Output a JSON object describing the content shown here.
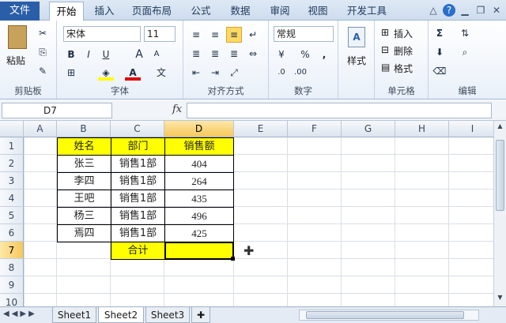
{
  "menu": {
    "file": "文件",
    "tabs": [
      "开始",
      "插入",
      "页面布局",
      "公式",
      "数据",
      "审阅",
      "视图",
      "开发工具"
    ]
  },
  "window_controls": {
    "minimize": "△",
    "help": "?",
    "restore": "❐",
    "close": "✕"
  },
  "ribbon": {
    "clipboard": {
      "paste": "粘贴",
      "label": "剪贴板"
    },
    "font": {
      "name": "宋体",
      "size": "11",
      "bold": "B",
      "italic": "I",
      "underline": "U",
      "grow": "A",
      "shrink": "A",
      "label": "字体"
    },
    "alignment": {
      "label": "对齐方式"
    },
    "number": {
      "format": "常规",
      "percent": "%",
      "comma": ",",
      "label": "数字"
    },
    "styles": {
      "label": "样式"
    },
    "cells": {
      "insert": "插入",
      "delete": "删除",
      "format": "格式",
      "label": "单元格"
    },
    "editing": {
      "sum": "Σ",
      "label": "编辑"
    }
  },
  "formula_bar": {
    "name_box": "D7",
    "fx": "fx",
    "formula": ""
  },
  "grid": {
    "columns": [
      "A",
      "B",
      "C",
      "D",
      "E",
      "F",
      "G",
      "H",
      "I"
    ],
    "rows": [
      "1",
      "2",
      "3",
      "4",
      "5",
      "6",
      "7",
      "8",
      "9",
      "10"
    ],
    "header": [
      "姓名",
      "部门",
      "销售额"
    ],
    "data": [
      [
        "张三",
        "销售1部",
        "404"
      ],
      [
        "李四",
        "销售1部",
        "264"
      ],
      [
        "王吧",
        "销售1部",
        "435"
      ],
      [
        "杨三",
        "销售1部",
        "496"
      ],
      [
        "焉四",
        "销售1部",
        "425"
      ]
    ],
    "total_label": "合计",
    "total_value": ""
  },
  "sheets": [
    "Sheet1",
    "Sheet2",
    "Sheet3"
  ],
  "active_sheet": "Sheet2",
  "colors": {
    "accent": "#2a5ea8",
    "highlight": "#ffff00",
    "selection": "#f6c85b"
  }
}
